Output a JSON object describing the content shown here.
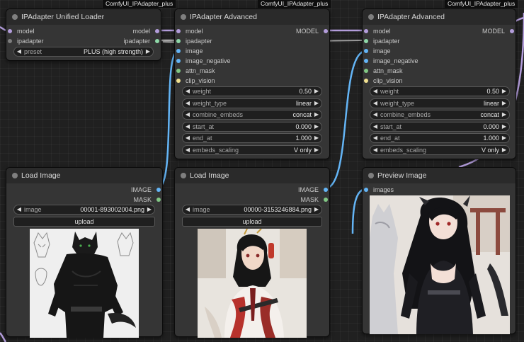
{
  "badges": [
    "ComfyUI_IPAdapter_plus",
    "ComfyUI_IPAdapter_plus",
    "ComfyUI_IPAdapter_plus"
  ],
  "unified_loader": {
    "title": "IPAdapter Unified Loader",
    "inputs": [
      "model",
      "ipadapter"
    ],
    "outputs": [
      "model",
      "ipadapter"
    ],
    "preset_label": "preset",
    "preset_value": "PLUS (high strength)"
  },
  "advanced_1": {
    "title": "IPAdapter Advanced",
    "output": "MODEL",
    "inputs": [
      "model",
      "ipadapter",
      "image",
      "image_negative",
      "attn_mask",
      "clip_vision"
    ],
    "widgets": [
      {
        "label": "weight",
        "value": "0.50"
      },
      {
        "label": "weight_type",
        "value": "linear"
      },
      {
        "label": "combine_embeds",
        "value": "concat"
      },
      {
        "label": "start_at",
        "value": "0.000"
      },
      {
        "label": "end_at",
        "value": "1.000"
      },
      {
        "label": "embeds_scaling",
        "value": "V only"
      }
    ]
  },
  "advanced_2": {
    "title": "IPAdapter Advanced",
    "output": "MODEL",
    "inputs": [
      "model",
      "ipadapter",
      "image",
      "image_negative",
      "attn_mask",
      "clip_vision"
    ],
    "widgets": [
      {
        "label": "weight",
        "value": "0.50"
      },
      {
        "label": "weight_type",
        "value": "linear"
      },
      {
        "label": "combine_embeds",
        "value": "concat"
      },
      {
        "label": "start_at",
        "value": "0.000"
      },
      {
        "label": "end_at",
        "value": "1.000"
      },
      {
        "label": "embeds_scaling",
        "value": "V only"
      }
    ]
  },
  "load_image_1": {
    "title": "Load Image",
    "outputs": [
      "IMAGE",
      "MASK"
    ],
    "image_label": "image",
    "image_value": "00001-893002004.png",
    "upload_label": "upload"
  },
  "load_image_2": {
    "title": "Load Image",
    "outputs": [
      "IMAGE",
      "MASK"
    ],
    "image_label": "image",
    "image_value": "00000-3153246884.png",
    "upload_label": "upload"
  },
  "preview": {
    "title": "Preview Image",
    "input": "images"
  },
  "colors": {
    "model_link": "#b39ddb",
    "ipadapter_link": "#8fd8a8",
    "image_link": "#64b5f6"
  }
}
